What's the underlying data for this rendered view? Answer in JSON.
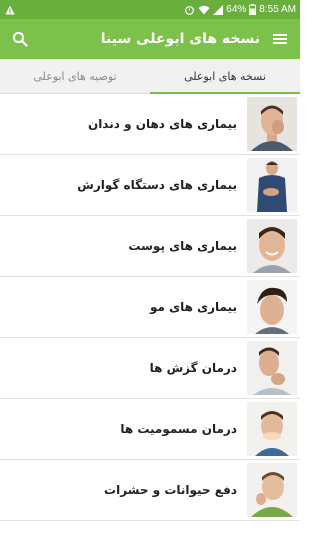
{
  "status": {
    "battery": "64%",
    "time": "8:55 AM"
  },
  "appbar": {
    "title": "نسخه های ابوعلی سینا",
    "menu_icon": "menu-icon",
    "search_icon": "search-icon"
  },
  "tabs": [
    {
      "label": "نسخه های ابوعلی",
      "active": true
    },
    {
      "label": "توصیه های ابوعلی",
      "active": false
    }
  ],
  "list": [
    {
      "label": "بیماری های دهان و دندان",
      "thumb": "toothache-man-photo"
    },
    {
      "label": "بیماری های دستگاه گوارش",
      "thumb": "stomach-ache-man-photo"
    },
    {
      "label": "بیماری های پوست",
      "thumb": "smiling-man-photo"
    },
    {
      "label": "بیماری های مو",
      "thumb": "man-hair-photo"
    },
    {
      "label": "درمان گزش ها",
      "thumb": "man-scratching-neck-photo"
    },
    {
      "label": "درمان مسمومیت ها",
      "thumb": "sick-boy-photo"
    },
    {
      "label": "دفع حیوانات و حشرات",
      "thumb": "boy-scratching-photo"
    }
  ],
  "colors": {
    "statusbar": "#6aaf3d",
    "appbar": "#7cc14a",
    "tab_indicator": "#7cc14a"
  }
}
